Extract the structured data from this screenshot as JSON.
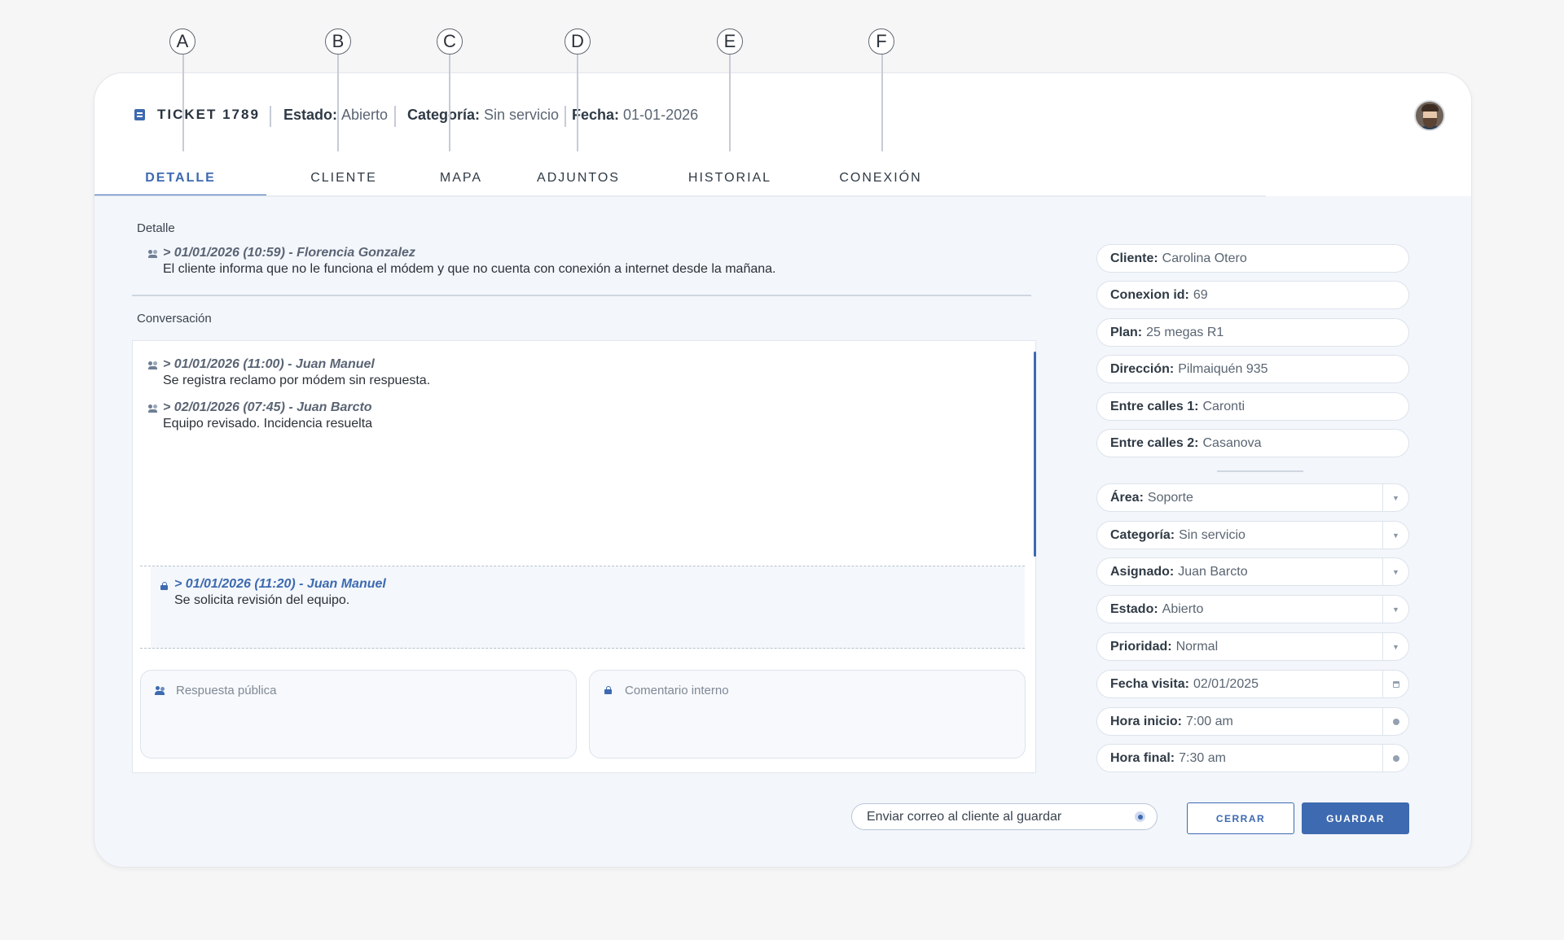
{
  "callouts": [
    "A",
    "B",
    "C",
    "D",
    "E",
    "F"
  ],
  "header": {
    "ticket_title": "TICKET 1789",
    "estado_label": "Estado:",
    "estado_value": "Abierto",
    "categoria_label": "Categoría:",
    "categoria_value": "Sin servicio",
    "fecha_label": "Fecha:",
    "fecha_value": "01-01-2026"
  },
  "tabs": [
    {
      "label": "DETALLE",
      "active": true
    },
    {
      "label": "CLIENTE",
      "active": false
    },
    {
      "label": "MAPA",
      "active": false
    },
    {
      "label": "ADJUNTOS",
      "active": false
    },
    {
      "label": "HISTORIAL",
      "active": false
    },
    {
      "label": "CONEXIÓN",
      "active": false
    }
  ],
  "detail": {
    "label": "Detalle",
    "entry": {
      "head": "> 01/01/2026 (10:59) - Florencia Gonzalez",
      "text": "El cliente informa que no le funciona el módem y que no cuenta con conexión a internet desde la mañana."
    }
  },
  "conversation": {
    "label": "Conversación",
    "messages": [
      {
        "head": "> 01/01/2026 (11:00) - Juan Manuel",
        "text": "Se registra reclamo por módem sin respuesta."
      },
      {
        "head": "> 02/01/2026 (07:45) - Juan Barcto",
        "text": "Equipo revisado. Incidencia resuelta"
      }
    ],
    "internal_note": {
      "head": "> 01/01/2026 (11:20) - Juan Manuel",
      "text": "Se solicita revisión del equipo."
    },
    "public_reply_placeholder": "Respuesta pública",
    "internal_comment_placeholder": "Comentario interno"
  },
  "client_info": [
    {
      "label": "Cliente:",
      "value": "Carolina Otero"
    },
    {
      "label": "Conexion id:",
      "value": "69"
    },
    {
      "label": "Plan:",
      "value": "25 megas R1"
    },
    {
      "label": "Dirección:",
      "value": "Pilmaiquén 935"
    },
    {
      "label": "Entre calles 1:",
      "value": "Caronti"
    },
    {
      "label": "Entre calles 2:",
      "value": "Casanova"
    }
  ],
  "ticket_fields": [
    {
      "label": "Área:",
      "value": "Soporte",
      "control": "dropdown"
    },
    {
      "label": "Categoría:",
      "value": "Sin servicio",
      "control": "dropdown"
    },
    {
      "label": "Asignado:",
      "value": "Juan Barcto",
      "control": "dropdown"
    },
    {
      "label": "Estado:",
      "value": "Abierto",
      "control": "dropdown"
    },
    {
      "label": "Prioridad:",
      "value": "Normal",
      "control": "dropdown"
    },
    {
      "label": "Fecha visita:",
      "value": "02/01/2025",
      "control": "calendar"
    },
    {
      "label": "Hora inicio:",
      "value": "7:00 am",
      "control": "clock"
    },
    {
      "label": "Hora final:",
      "value": "7:30 am",
      "control": "clock"
    }
  ],
  "footer": {
    "email_toggle_label": "Enviar correo al cliente al guardar",
    "email_toggle_on": true,
    "close_label": "CERRAR",
    "save_label": "GUARDAR"
  },
  "colors": {
    "accent": "#3d6ab0",
    "background": "#f3f6fb"
  }
}
